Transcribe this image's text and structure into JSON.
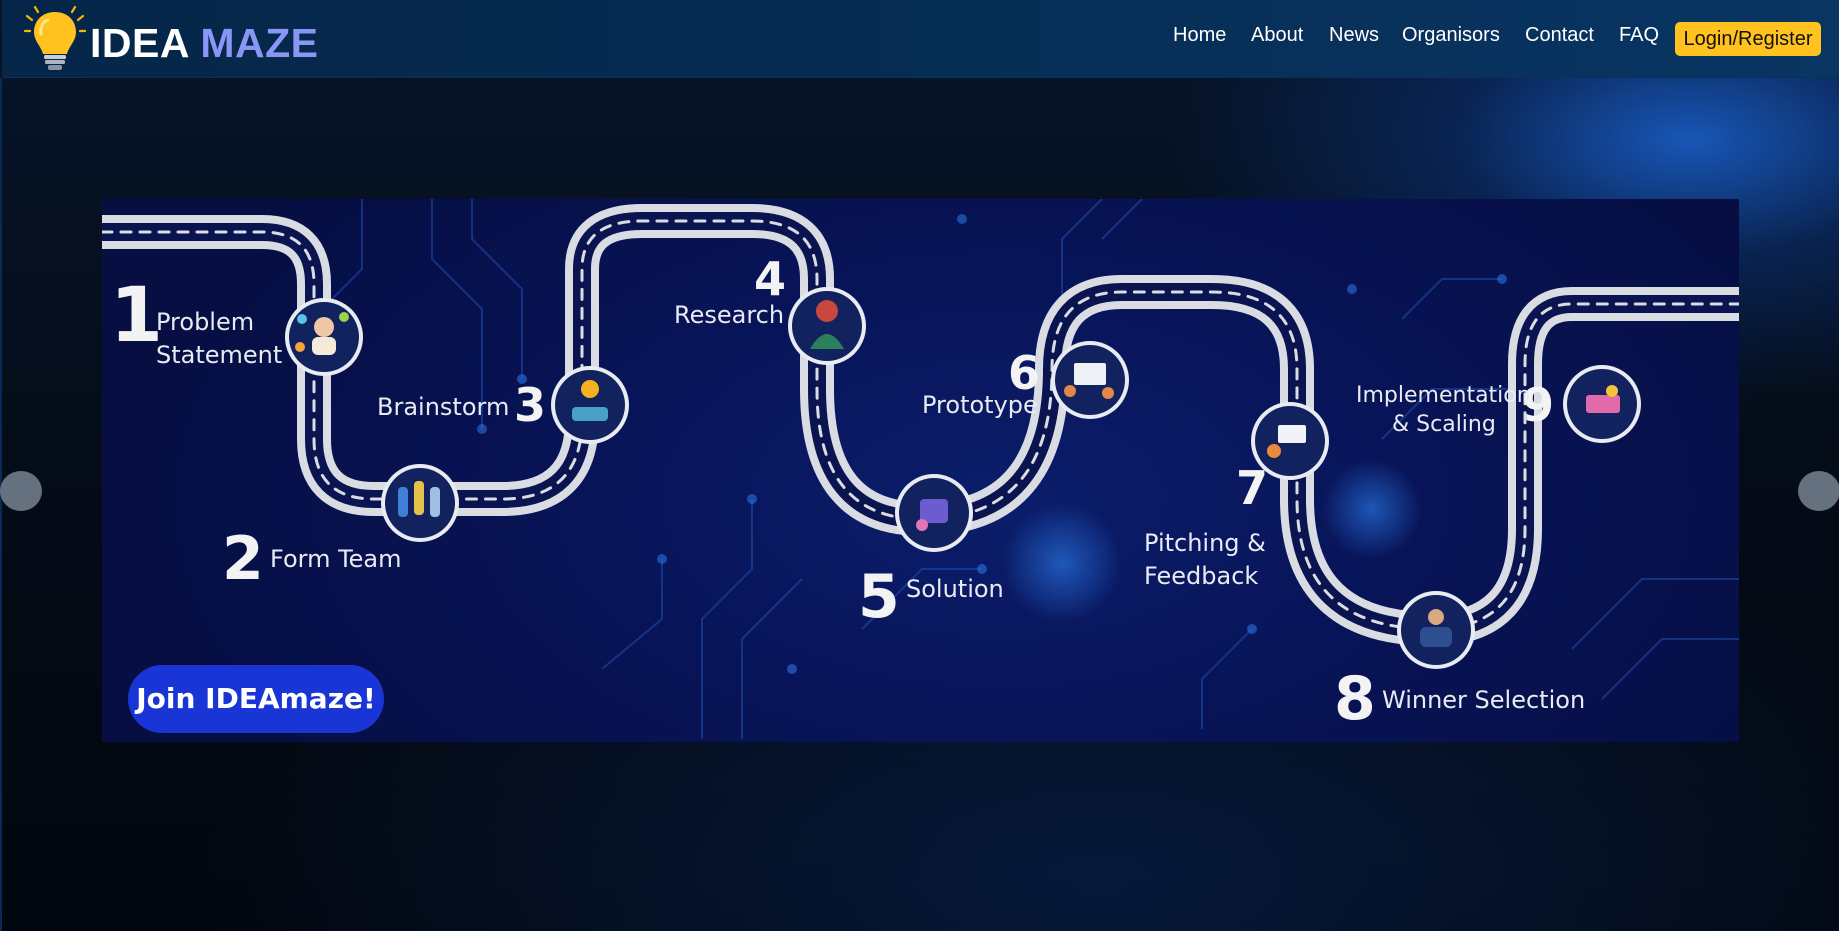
{
  "brand": {
    "word1": "IDEA",
    "word2": "MAZE"
  },
  "nav": {
    "items": [
      "Home",
      "About",
      "News",
      "Organisors",
      "Contact",
      "FAQ"
    ],
    "login_label": "Login/Register"
  },
  "slide": {
    "steps": [
      {
        "num": "1",
        "label1": "Problem",
        "label2": "Statement"
      },
      {
        "num": "2",
        "label1": "Form Team",
        "label2": ""
      },
      {
        "num": "3",
        "label1": "Brainstorm",
        "label2": ""
      },
      {
        "num": "4",
        "label1": "Research",
        "label2": ""
      },
      {
        "num": "5",
        "label1": "Solution",
        "label2": ""
      },
      {
        "num": "6",
        "label1": "Prototype",
        "label2": ""
      },
      {
        "num": "7",
        "label1": "Pitching &",
        "label2": "Feedback"
      },
      {
        "num": "8",
        "label1": "Winner Selection",
        "label2": ""
      },
      {
        "num": "9",
        "label1": "Implementation",
        "label2": "& Scaling"
      }
    ],
    "cta_label": "Join IDEAmaze!"
  },
  "colors": {
    "accent": "#ffc21f",
    "brand_secondary": "#8a96f5",
    "header_bg": "#062c52",
    "slide_bg": "#081458",
    "cta_bg": "#1a35d6",
    "road": "#d9dde3"
  },
  "icons": {
    "logo": "lightbulb-icon",
    "prev": "carousel-prev-icon",
    "next": "carousel-next-icon"
  }
}
